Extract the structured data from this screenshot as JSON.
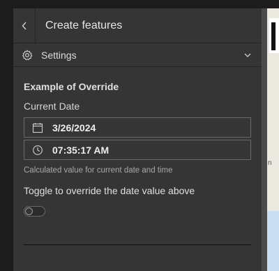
{
  "header": {
    "title": "Create features"
  },
  "settings": {
    "label": "Settings"
  },
  "form": {
    "section_title": "Example of Override",
    "date_label": "Current Date",
    "date_value": "3/26/2024",
    "time_value": "07:35:17 AM",
    "hint": "Calculated value for current date and time",
    "toggle_label": "Toggle to override the date value above",
    "toggle_on": false
  },
  "icons": {
    "back": "chevron-left-icon",
    "settings": "gear-icon",
    "expand": "chevron-down-icon",
    "date": "calendar-icon",
    "time": "clock-icon"
  },
  "map_fragments": [
    "n",
    "n"
  ]
}
